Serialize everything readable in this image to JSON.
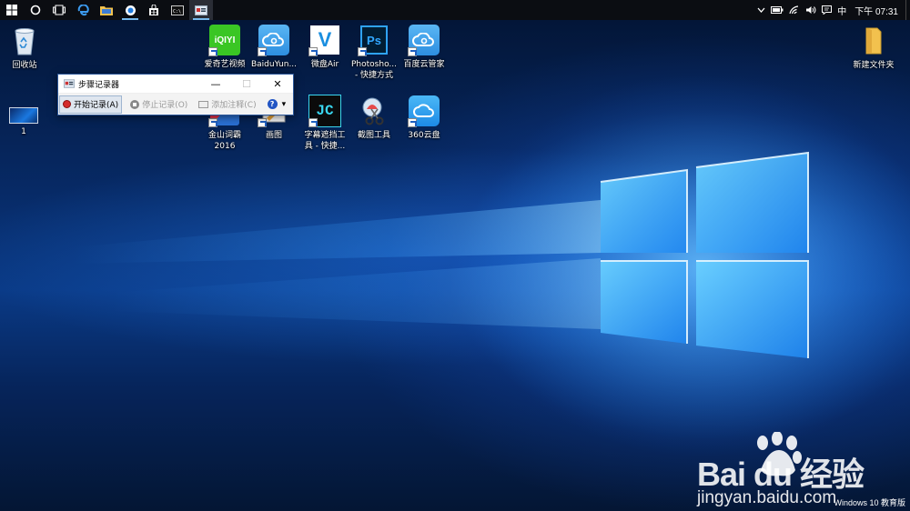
{
  "taskbar": {
    "apps": [
      {
        "name": "start-button",
        "icon": "windows-logo-icon"
      },
      {
        "name": "cortana-button",
        "icon": "cortana-circle-icon"
      },
      {
        "name": "task-view-button",
        "icon": "task-view-icon"
      },
      {
        "name": "edge-app",
        "icon": "edge-icon"
      },
      {
        "name": "file-explorer-app",
        "icon": "folder-icon"
      },
      {
        "name": "browser-app",
        "icon": "browser-icon"
      },
      {
        "name": "store-app",
        "icon": "store-icon"
      },
      {
        "name": "cmd-app",
        "icon": "cmd-icon"
      },
      {
        "name": "steps-recorder-app",
        "icon": "steps-recorder-icon"
      }
    ],
    "tray": {
      "ime": "中",
      "time": "下午 07:31"
    }
  },
  "desktop": {
    "icons": [
      {
        "label": "回收站",
        "icon": "recycle-bin-icon"
      },
      {
        "label": "1",
        "icon": "screenshot-thumbnail-icon"
      },
      {
        "label": "爱奇艺视频",
        "icon": "iqiyi-icon",
        "glyph": "iQIYI",
        "color": "#3ac624"
      },
      {
        "label": "BaiduYun...",
        "icon": "baidu-cloud-icon"
      },
      {
        "label": "微盘Air",
        "icon": "weipan-icon",
        "glyph": "V"
      },
      {
        "label": "Photosho...\n- 快捷方式",
        "icon": "photoshop-icon",
        "glyph": "Ps"
      },
      {
        "label": "百度云管家",
        "icon": "baidu-cloud-manager-icon"
      },
      {
        "label": "金山词霸\n2016",
        "icon": "kingsoft-powerword-icon"
      },
      {
        "label": "画图",
        "icon": "paint-icon"
      },
      {
        "label": "字幕遮挡工\n具 - 快捷...",
        "icon": "subtitle-tool-icon",
        "glyph": "JC"
      },
      {
        "label": "截图工具",
        "icon": "snipping-tool-icon"
      },
      {
        "label": "360云盘",
        "icon": "360-cloud-icon"
      },
      {
        "label": "新建文件夹",
        "icon": "folder-icon"
      }
    ]
  },
  "steps_recorder": {
    "title": "步骤记录器",
    "minimize": "—",
    "maximize": "☐",
    "close": "✕",
    "start_label": "开始记录(A)",
    "stop_label": "停止记录(O)",
    "comment_label": "添加注释(C)",
    "help": "?",
    "dropdown": "▾"
  },
  "watermark": {
    "logo": "Bai du 经验",
    "url": "jingyan.baidu.com"
  },
  "edition": "Windows 10 教育版",
  "colors": {
    "accent": "#0078d7",
    "taskbar": "#0b0d12",
    "record_red": "#d42b2b",
    "help_blue": "#2255c4"
  }
}
